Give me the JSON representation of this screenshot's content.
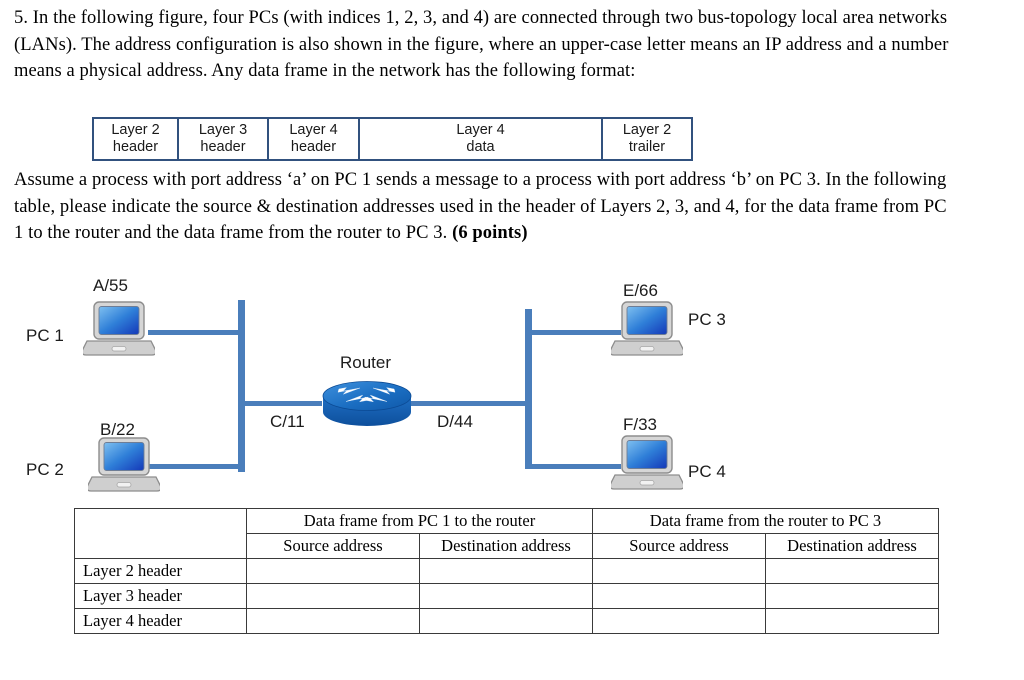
{
  "question": {
    "intro_html": "5. In the following figure, four PCs (with indices 1, 2, 3, and 4) are connected through two bus-topology local area networks (LANs). The address configuration is also shown in the figure, where an upper-case letter means an IP address and a number means a physical address. Any data frame in the network has the following format:",
    "assume_html": "Assume a process with port address ‘a’ on PC 1 sends a message to a process with port address ‘b’ on PC 3. In the following table, please indicate the source &amp; destination addresses used in the header of Layers 2, 3, and 4, for the data frame from PC 1 to the router and the data frame from the router to PC 3. <span class=\"bold\">(6 points)</span>"
  },
  "frame_format": {
    "cells": [
      {
        "line1": "Layer 2",
        "line2": "header"
      },
      {
        "line1": "Layer 3",
        "line2": "header"
      },
      {
        "line1": "Layer 4",
        "line2": "header"
      },
      {
        "line1": "Layer 4",
        "line2": "data"
      },
      {
        "line1": "Layer 2",
        "line2": "trailer"
      }
    ],
    "border_color": "#31517e"
  },
  "diagram": {
    "link_color": "#4a7ebb",
    "router_color": "#1f6fc4",
    "nodes": [
      {
        "id": "pc1",
        "name_label": "PC 1",
        "addr_label": "A/55"
      },
      {
        "id": "pc2",
        "name_label": "PC 2",
        "addr_label": "B/22"
      },
      {
        "id": "pc3",
        "name_label": "PC 3",
        "addr_label": "E/66"
      },
      {
        "id": "pc4",
        "name_label": "PC 4",
        "addr_label": "F/33"
      }
    ],
    "router": {
      "name_label": "Router",
      "left_interface_label": "C/11",
      "right_interface_label": "D/44"
    }
  },
  "answer_table": {
    "corner_label": "",
    "group_headers": [
      "Data frame from PC 1 to the router",
      "Data frame from the router to PC 3"
    ],
    "sub_headers": [
      "Source address",
      "Destination address",
      "Source address",
      "Destination address"
    ],
    "rows": [
      {
        "label": "Layer 2 header",
        "cells": [
          "",
          "",
          "",
          ""
        ]
      },
      {
        "label": "Layer 3 header",
        "cells": [
          "",
          "",
          "",
          ""
        ]
      },
      {
        "label": "Layer 4 header",
        "cells": [
          "",
          "",
          "",
          ""
        ]
      }
    ]
  }
}
